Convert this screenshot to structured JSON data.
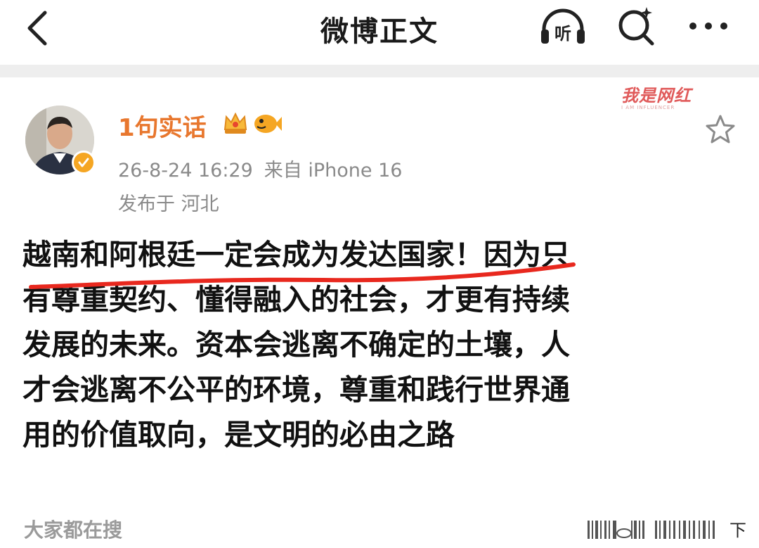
{
  "header": {
    "title": "微博正文",
    "listen_label": "听"
  },
  "post": {
    "watermark": {
      "main": "我是网红",
      "sub": "I AM INFLUENCER"
    },
    "author": {
      "name": "1句实话"
    },
    "meta": {
      "time": "26-8-24 16:29",
      "source": "来自 iPhone 16",
      "location": "发布于 河北"
    },
    "content_lines": [
      "越南和阿根廷一定会成为发达国家！因为只",
      "有尊重契约、懂得融入的社会，才更有持续",
      "发展的未来。资本会逃离不确定的土壤，人",
      "才会逃离不公平的环境，尊重和践行世界通",
      "用的价值取向，是文明的必由之路"
    ],
    "underline_color": "#e8281e"
  },
  "footer": {
    "hot_search_label": "大家都在搜",
    "download_label": "下"
  },
  "colors": {
    "username": "#e8772e",
    "meta": "#8a8a8a",
    "separator": "#eeeeee"
  }
}
